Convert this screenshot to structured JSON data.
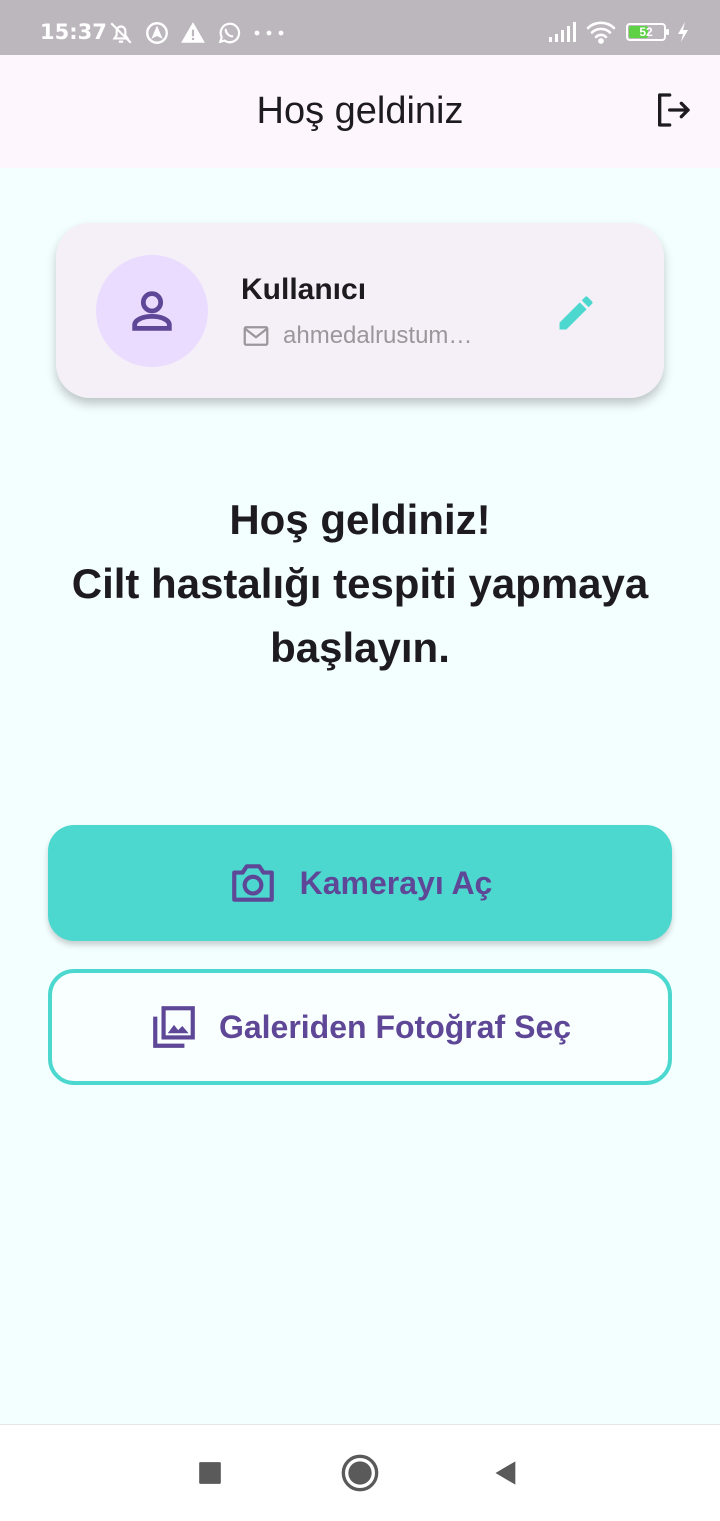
{
  "status_bar": {
    "time": "15:37",
    "battery_level": "52",
    "icons_left": [
      "bell-off-icon",
      "location-icon",
      "warning-icon",
      "whatsapp-icon",
      "more-dots-icon"
    ],
    "icons_right": [
      "signal-icon",
      "wifi-icon",
      "battery-icon",
      "charging-icon"
    ]
  },
  "app_bar": {
    "title": "Hoş geldiniz",
    "logout_icon": "logout-icon"
  },
  "profile": {
    "name": "Kullanıcı",
    "email": "ahmedalrustum…",
    "avatar_icon": "person-icon",
    "mail_icon": "mail-icon",
    "edit_icon": "pencil-icon"
  },
  "welcome": {
    "line1": "Hoş geldiniz!",
    "line2": "Cilt hastalığı tespiti yapmaya başlayın."
  },
  "actions": {
    "camera_label": "Kamerayı Aç",
    "gallery_label": "Galeriden Fotoğraf Seç"
  },
  "colors": {
    "accent": "#4dd8cf",
    "primary_text": "#5e4796",
    "avatar_bg": "#eadcff",
    "appbar_bg": "#fdf6fd",
    "page_bg": "#f3fefe"
  },
  "nav": {
    "items": [
      "recents-square-icon",
      "home-circle-icon",
      "back-triangle-icon"
    ]
  }
}
